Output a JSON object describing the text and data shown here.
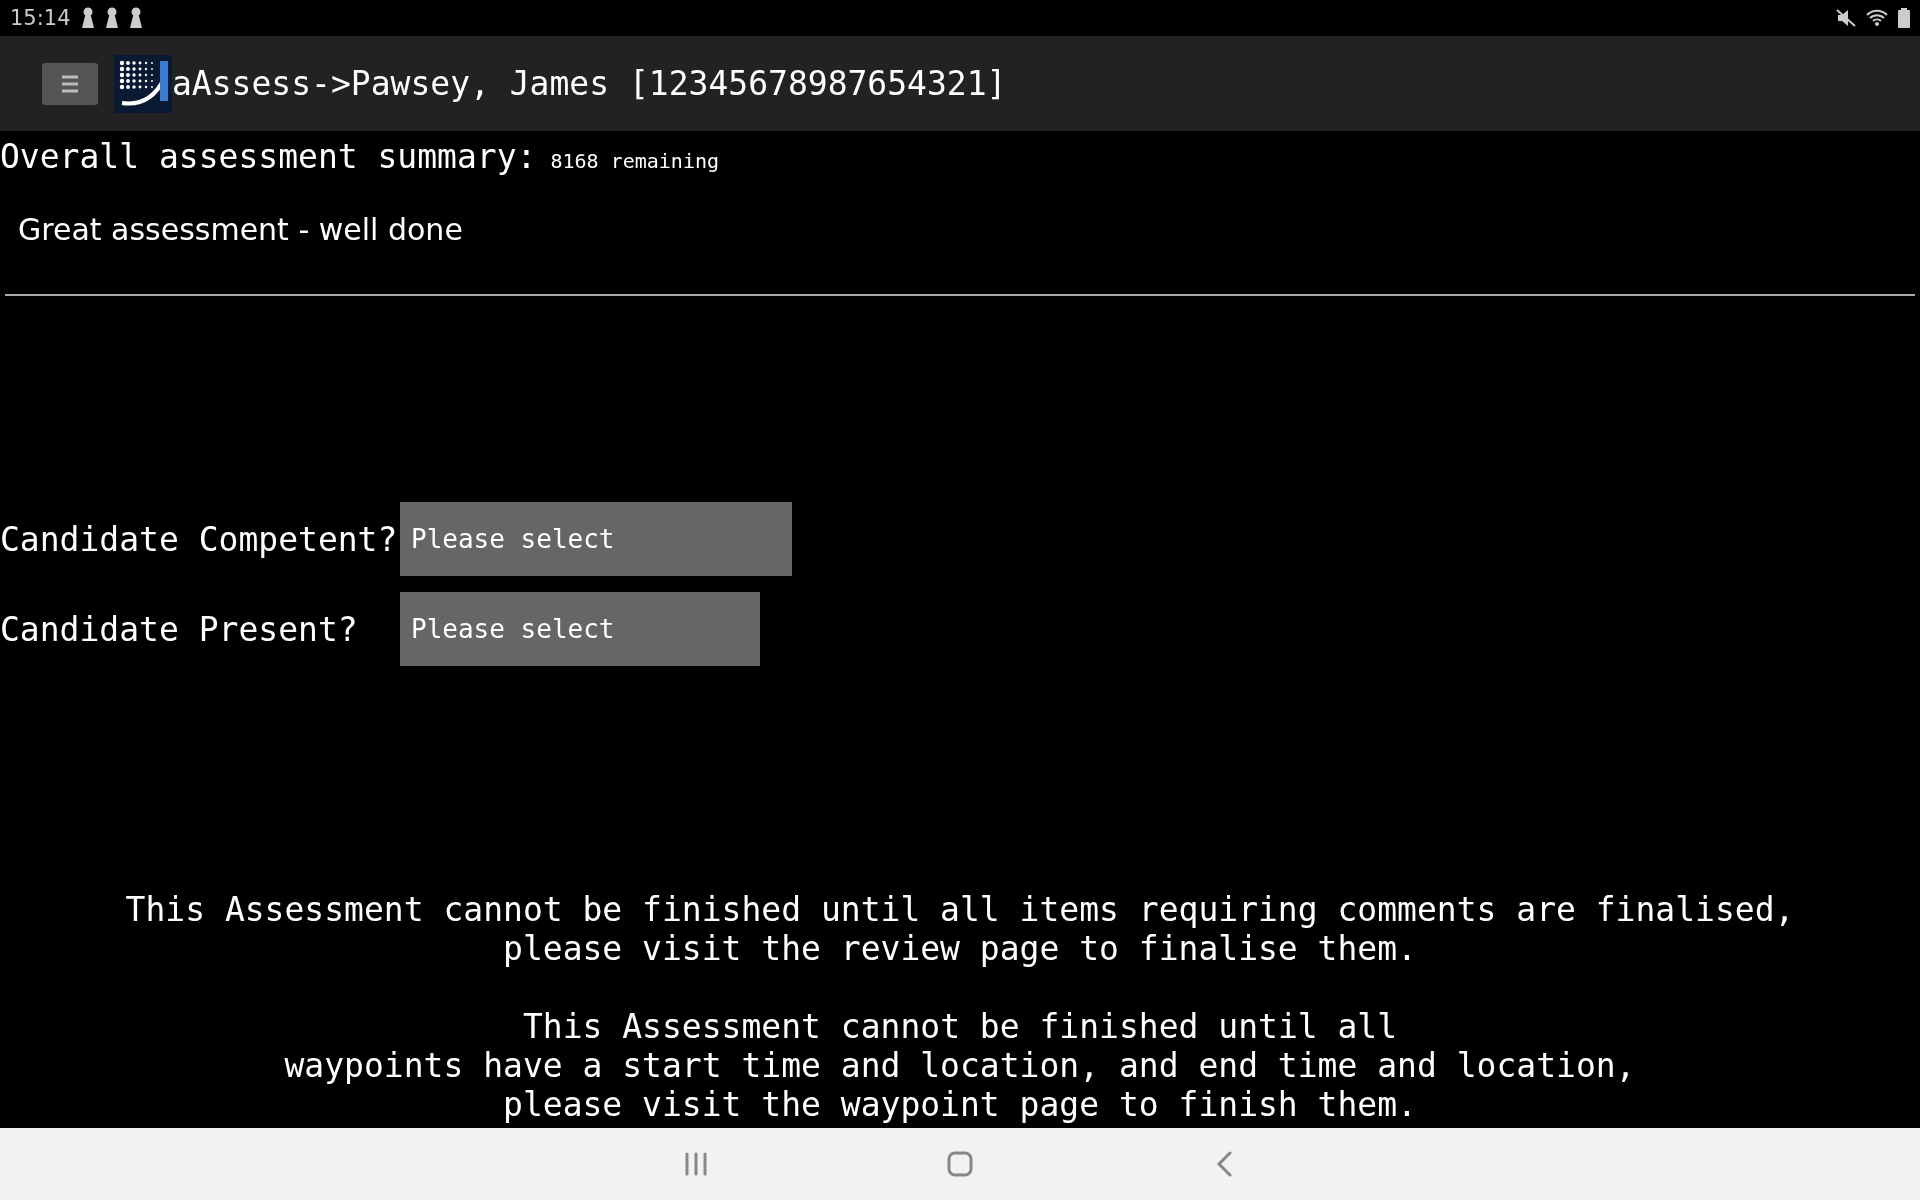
{
  "status_bar": {
    "time": "15:14"
  },
  "header": {
    "title": "aAssess->Pawsey, James [12345678987654321]"
  },
  "summary": {
    "label": "Overall assessment summary:",
    "remaining": "8168 remaining",
    "value": "Great assessment - well done"
  },
  "questions": [
    {
      "label": "Candidate Competent?",
      "value": "Please select"
    },
    {
      "label": "Candidate Present?",
      "value": "Please select"
    }
  ],
  "messages": [
    {
      "lines": [
        "This Assessment cannot be finished until all items requiring comments are finalised,",
        "please visit the review page to finalise them."
      ]
    },
    {
      "lines": [
        "This Assessment cannot be finished until all",
        "waypoints have a start time and location, and end time and location,",
        "please visit the waypoint page to finish them."
      ]
    }
  ]
}
